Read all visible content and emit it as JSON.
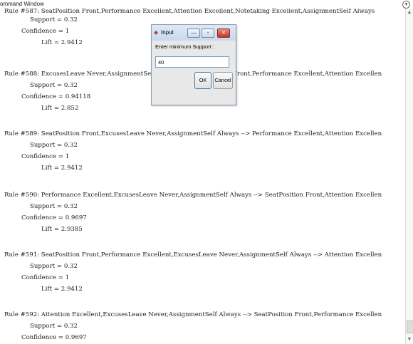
{
  "window": {
    "title": "ommand Window",
    "menu_icon": "circle-down-arrow-icon"
  },
  "console": {
    "top_line": "Rule #587: SeatPosition Front,Performance Excellent,Attention Excellent,Notetaking Excellent,AssignmentSelf Always",
    "top_kv": [
      {
        "text": "Support = 0.32"
      },
      {
        "text": "Confidence = 1"
      },
      {
        "text": "Lift = 2.9412"
      }
    ],
    "rules": [
      {
        "line": "Rule #588: ExcusesLeave Never,AssignmentSelf Always --> SeatPosition Front,Performance Excellent,Attention Excellen",
        "support": "Support = 0.32",
        "confidence": "Confidence = 0.94118",
        "lift": "Lift = 2.852"
      },
      {
        "line": "Rule #589: SeatPosition Front,ExcusesLeave Never,AssignmentSelf Always --> Performance Excellent,Attention Excellen",
        "support": "Support = 0.32",
        "confidence": "Confidence = 1",
        "lift": "Lift = 2.9412"
      },
      {
        "line": "Rule #590: Performance Excellent,ExcusesLeave Never,AssignmentSelf Always --> SeatPosition Front,Attention Excellen",
        "support": "Support = 0.32",
        "confidence": "Confidence = 0.9697",
        "lift": "Lift = 2.9385"
      },
      {
        "line": "Rule #591: SeatPosition Front,Performance Excellent,ExcusesLeave Never,AssignmentSelf Always --> Attention Excellen",
        "support": "Support = 0.32",
        "confidence": "Confidence = 1",
        "lift": "Lift = 2.9412"
      },
      {
        "line": "Rule #592: Attention Excellent,ExcusesLeave Never,AssignmentSelf Always --> SeatPosition Front,Performance Excellen",
        "support": "Support = 0.32",
        "confidence": "Confidence = 0.9697",
        "lift": ""
      }
    ]
  },
  "dialog": {
    "title": "Input",
    "prompt": "Enter minimum Support :",
    "value": "40",
    "ok_label": "OK",
    "cancel_label": "Cancel",
    "close_color": "#c0392b"
  }
}
